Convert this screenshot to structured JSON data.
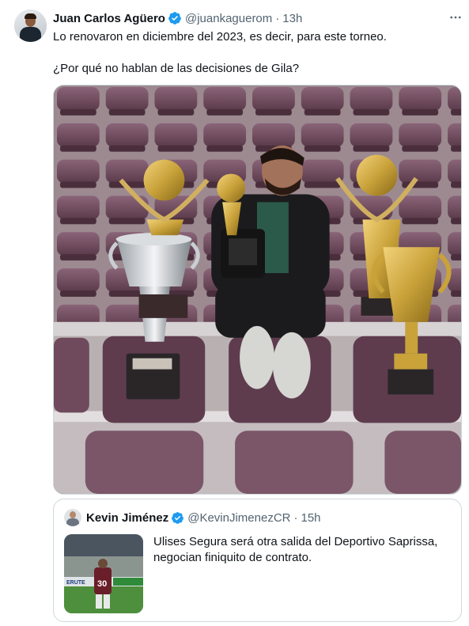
{
  "tweet": {
    "author": {
      "display_name": "Juan Carlos Agüero",
      "handle": "@juankaguerom",
      "verified": true
    },
    "separator": "·",
    "time": "13h",
    "text_line1": "Lo renovaron en diciembre del 2023, es decir, para este torneo.",
    "text_line2": "¿Por qué no hablan de las decisiones de Gila?",
    "more_icon": "more-horizontal-icon",
    "media_description_icon": "photo"
  },
  "quoted_tweet": {
    "author": {
      "display_name": "Kevin Jiménez",
      "handle": "@KevinJimenezCR",
      "verified": true
    },
    "separator": "·",
    "time": "15h",
    "text": "Ulises Segura será otra salida del Deportivo Saprissa, negocian finiquito de contrato.",
    "thumb_jersey_number": "30",
    "thumb_banner_text": "ERUTE"
  },
  "colors": {
    "verified_blue": "#1d9bf0",
    "secondary_text": "#536471",
    "border": "#cfd9de",
    "seat_purple": "#6e4a5c",
    "trophy_gold": "#c9a23a"
  }
}
